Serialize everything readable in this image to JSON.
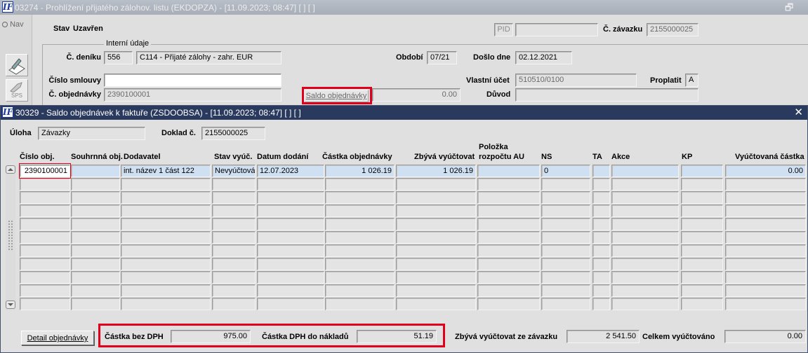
{
  "bg_window": {
    "title": "03274 - Prohlížení přijatého zálohov. listu (EKDOPZA) - [11.09.2023; 08:47]  [ ]  [ ]",
    "restore_glyph": "🗗",
    "nav_label": "Nav",
    "tool_sps_label": "SPS",
    "stav_label": "Stav",
    "stav_value": "Uzavřen",
    "pid_label": "PID",
    "pid_value": "",
    "c_zavazku_label": "Č. závazku",
    "c_zavazku_value": "2155000025",
    "interni_udaje_label": "Interní údaje",
    "c_deniku_label": "Č. deníku",
    "c_deniku_value": "556",
    "denik_name": "C114 - Přijaté zálohy - zahr. EUR",
    "obdobi_label": "Období",
    "obdobi_value": "07/21",
    "doslo_dne_label": "Došlo dne",
    "doslo_dne_value": "02.12.2021",
    "cislo_smlouvy_label": "Číslo smlouvy",
    "cislo_smlouvy_value": "",
    "vlastni_ucet_label": "Vlastní účet",
    "vlastni_ucet_value": "510510/0100",
    "proplatit_label": "Proplatit",
    "proplatit_value": "A",
    "c_objednavky_label": "Č. objednávky",
    "c_objednavky_value": "2390100001",
    "saldo_button_label": "Saldo objednávky",
    "saldo_value": "0.00",
    "duvod_label": "Důvod",
    "duvod_value": ""
  },
  "fg_window": {
    "title": "30329 - Saldo objednávek k faktuře (ZSDOOBSA) - [11.09.2023; 08:47]  [ ]  [ ]",
    "close_glyph": "✕",
    "uloha_label": "Úloha",
    "uloha_value": "Závazky",
    "doklad_label": "Doklad č.",
    "doklad_value": "2155000025",
    "columns": {
      "cislo_obj": "Číslo obj.",
      "souhrnna_obj": "Souhrnná obj.",
      "dodavatel": "Dodavatel",
      "stav_vyuc": "Stav vyúč.",
      "datum_dodani": "Datum dodání",
      "castka_obj": "Částka objednávky",
      "zbyva_vyuctovat": "Zbývá vyúčtovat",
      "polozka_line1": "Položka",
      "polozka_line2": "rozpočtu AU",
      "ns": "NS",
      "ta": "TA",
      "akce": "Akce",
      "kp": "KP",
      "vyuctovana_castka": "Vyúčtovaná částka"
    },
    "first_row": {
      "cislo_obj": "2390100001",
      "souhrnna_obj": "",
      "dodavatel": "int. název 1 část 122",
      "stav_vyuc": "Nevyúčtován",
      "datum_dodani": "12.07.2023",
      "castka_obj": "1 026.19",
      "zbyva_vyuctovat": "1 026.19",
      "polozka": "",
      "ns": "0",
      "ta": "",
      "akce": "",
      "kp": "",
      "vyuctovana_castka": "0.00"
    },
    "detail_button_label": "Detail objednávky",
    "castka_bez_dph_label": "Částka bez DPH",
    "castka_bez_dph_value": "975.00",
    "castka_dph_label": "Částka DPH do nákladů",
    "castka_dph_value": "51.19",
    "zbyva_ze_zavazku_label": "Zbývá vyúčtovat ze závazku",
    "zbyva_ze_zavazku_value": "2 541.50",
    "celkem_label": "Celkem vyúčtováno",
    "celkem_value": "0.00"
  },
  "colors": {
    "highlight": "#e0001b",
    "selected_cell": "#cfe0f2",
    "active_title": "#2a3a5e"
  }
}
